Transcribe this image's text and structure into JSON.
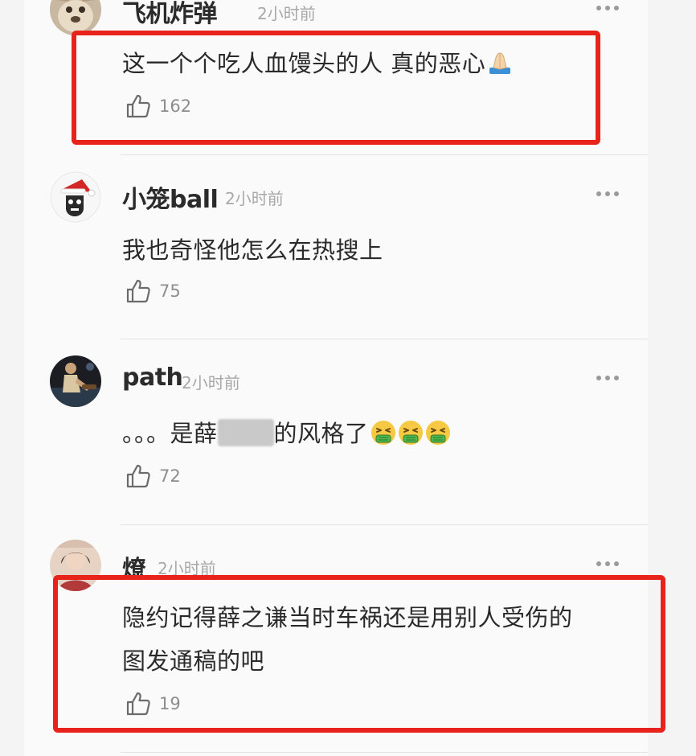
{
  "comments": [
    {
      "username": "飞机炸弹",
      "time": "2小时前",
      "text": "这一个个吃人血馒头的人 真的恶心",
      "emoji": "folded-hands",
      "likes": "162",
      "highlighted": true
    },
    {
      "username": "小笼ball",
      "time": "2小时前",
      "text": "我也奇怪他怎么在热搜上",
      "likes": "75",
      "highlighted": false
    },
    {
      "username": "path",
      "time": "2小时前",
      "text_prefix": "。。。是薛",
      "text_suffix": "的风格了",
      "emoji": "nauseated-face",
      "likes": "72",
      "highlighted": false
    },
    {
      "username": "燎",
      "time": "2小时前",
      "text_line1": "隐约记得薛之谦当时车祸还是用别人受伤的",
      "text_line2": "图发通稿的吧",
      "likes": "19",
      "highlighted": true
    }
  ],
  "colors": {
    "highlight_border": "#e8231b",
    "username": "#2b2b2b",
    "meta": "#a8a8a8"
  }
}
